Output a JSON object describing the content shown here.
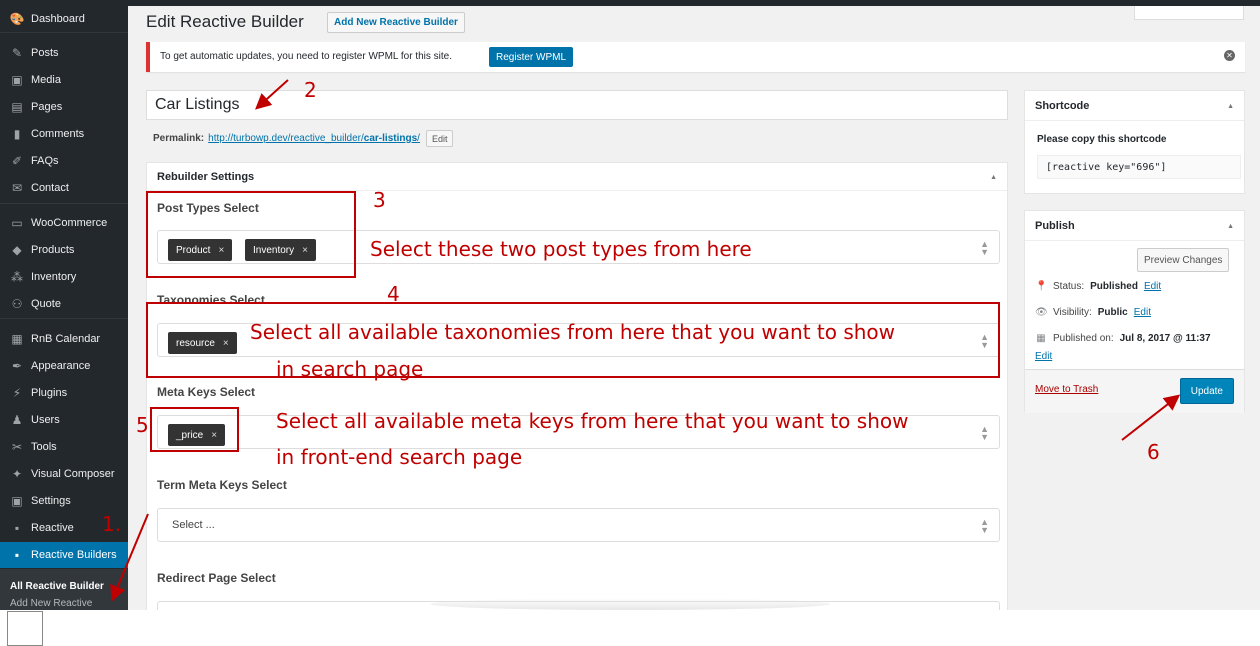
{
  "sidebar": {
    "items": [
      {
        "label": "Dashboard",
        "icon": "dashboard-icon",
        "glyph": "🎨"
      },
      {
        "label": "Posts",
        "icon": "pin-icon",
        "glyph": "✎"
      },
      {
        "label": "Media",
        "icon": "media-icon",
        "glyph": "▣"
      },
      {
        "label": "Pages",
        "icon": "pages-icon",
        "glyph": "▤"
      },
      {
        "label": "Comments",
        "icon": "comments-icon",
        "glyph": "▮"
      },
      {
        "label": "FAQs",
        "icon": "faq-icon",
        "glyph": "✐"
      },
      {
        "label": "Contact",
        "icon": "mail-icon",
        "glyph": "✉"
      },
      {
        "label": "WooCommerce",
        "icon": "woocommerce-icon",
        "glyph": "▭"
      },
      {
        "label": "Products",
        "icon": "products-icon",
        "glyph": "◆"
      },
      {
        "label": "Inventory",
        "icon": "inventory-icon",
        "glyph": "⁂"
      },
      {
        "label": "Quote",
        "icon": "quote-icon",
        "glyph": "⚇"
      },
      {
        "label": "RnB Calendar",
        "icon": "calendar-icon",
        "glyph": "▦"
      },
      {
        "label": "Appearance",
        "icon": "appearance-icon",
        "glyph": "✒"
      },
      {
        "label": "Plugins",
        "icon": "plugins-icon",
        "glyph": "⚡"
      },
      {
        "label": "Users",
        "icon": "users-icon",
        "glyph": "♟"
      },
      {
        "label": "Tools",
        "icon": "tools-icon",
        "glyph": "✂"
      },
      {
        "label": "Visual Composer",
        "icon": "visual-composer-icon",
        "glyph": "✦"
      },
      {
        "label": "Settings",
        "icon": "settings-icon",
        "glyph": "▣"
      },
      {
        "label": "Reactive",
        "icon": "reactive-icon",
        "glyph": "▪"
      },
      {
        "label": "Reactive Builders",
        "icon": "reactive-builders-icon",
        "glyph": "▪"
      }
    ],
    "submenu_active": "All Reactive Builder",
    "submenu_next": "Add New Reactive"
  },
  "header": {
    "title": "Edit Reactive Builder",
    "add_new_label": "Add New Reactive Builder"
  },
  "notice": {
    "text": "To get automatic updates, you need to register WPML for this site.",
    "button_label": "Register WPML",
    "dismiss_glyph": "✕"
  },
  "post": {
    "title": "Car Listings",
    "permalink_label": "Permalink:",
    "permalink_base": "http://turbowp.dev/reactive_builder/",
    "permalink_slug": "car-listings",
    "permalink_tail": "/",
    "permalink_edit": "Edit"
  },
  "settings": {
    "title": "Rebuilder Settings",
    "post_types_label": "Post Types Select",
    "post_types": [
      "Product",
      "Inventory"
    ],
    "taxonomies_label": "Taxonomies Select",
    "taxonomies": [
      "resource"
    ],
    "meta_keys_label": "Meta Keys Select",
    "meta_keys": [
      "_price"
    ],
    "term_meta_label": "Term Meta Keys Select",
    "term_meta_placeholder": "Select ...",
    "redirect_label": "Redirect Page Select",
    "chip_remove": "×"
  },
  "shortcode": {
    "title": "Shortcode",
    "note": "Please copy this shortcode",
    "value": "[reactive key=\"696\"]"
  },
  "publish": {
    "title": "Publish",
    "preview_label": "Preview Changes",
    "status_label": "Status:",
    "status_value": "Published",
    "visibility_label": "Visibility:",
    "visibility_value": "Public",
    "published_label": "Published on:",
    "published_value": "Jul 8, 2017 @ 11:37",
    "edit_label": "Edit",
    "trash_label": "Move to Trash",
    "update_label": "Update"
  },
  "annotations": {
    "step1": "1.",
    "step2": "2",
    "step3": "3",
    "step4": "4",
    "step5": "5",
    "step6": "6",
    "note_post_types": "Select these two post types from here",
    "note_taxonomies_line1": "Select all available taxonomies from here that you want to show",
    "note_taxonomies_line2": "in search page",
    "note_meta_line1": "Select all available meta keys from here that you want to show",
    "note_meta_line2": "in front-end search page",
    "color": "#c00000"
  },
  "colors": {
    "sidebar_bg": "#23282d",
    "accent": "#0073aa",
    "notice_border": "#dc3232"
  }
}
